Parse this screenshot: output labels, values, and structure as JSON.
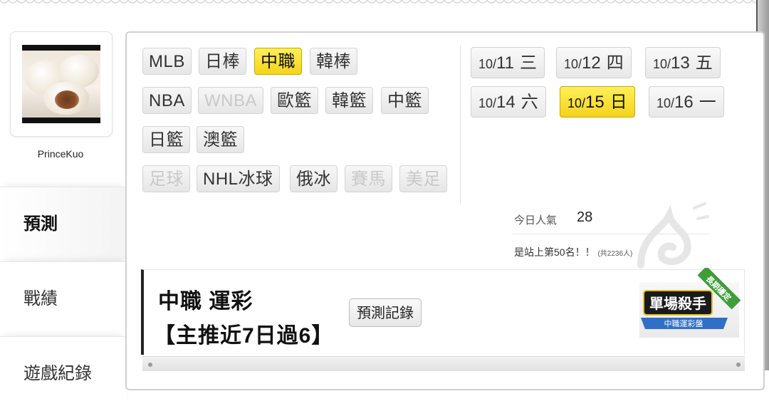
{
  "profile": {
    "username": "PrinceKuo",
    "avatar_alt": "steamed buns"
  },
  "left_menu": [
    {
      "label": "預測",
      "active": true
    },
    {
      "label": "戰績",
      "active": false
    },
    {
      "label": "遊戲紀錄",
      "active": false
    }
  ],
  "sports": {
    "rows": [
      [
        {
          "label": "MLB",
          "state": "normal"
        },
        {
          "label": "日棒",
          "state": "normal"
        },
        {
          "label": "中職",
          "state": "active"
        },
        {
          "label": "韓棒",
          "state": "normal"
        }
      ],
      [
        {
          "label": "NBA",
          "state": "normal"
        },
        {
          "label": "WNBA",
          "state": "disabled"
        },
        {
          "label": "歐籃",
          "state": "normal"
        },
        {
          "label": "韓籃",
          "state": "normal"
        },
        {
          "label": "中籃",
          "state": "normal"
        }
      ],
      [
        {
          "label": "日籃",
          "state": "normal"
        },
        {
          "label": "澳籃",
          "state": "normal"
        }
      ],
      [
        {
          "label": "足球",
          "state": "disabled"
        },
        {
          "label": "NHL冰球",
          "state": "normal"
        },
        {
          "label": "俄冰",
          "state": "normal"
        },
        {
          "label": "賽馬",
          "state": "disabled"
        },
        {
          "label": "美足",
          "state": "disabled"
        }
      ]
    ]
  },
  "dates": [
    {
      "md": "10/",
      "d": "11",
      "weekday": "三",
      "active": false
    },
    {
      "md": "10/",
      "d": "12",
      "weekday": "四",
      "active": false
    },
    {
      "md": "10/",
      "d": "13",
      "weekday": "五",
      "active": false
    },
    {
      "md": "10/",
      "d": "14",
      "weekday": "六",
      "active": false
    },
    {
      "md": "10/",
      "d": "15",
      "weekday": "日",
      "active": true
    },
    {
      "md": "10/",
      "d": "16",
      "weekday": "一",
      "active": false
    }
  ],
  "stats": {
    "today_popularity_label": "今日人氣",
    "today_popularity_value": "28",
    "rank_text": "是站上第50名！！",
    "rank_total": "(共2236人)"
  },
  "pick": {
    "title": "中職 運彩",
    "subtitle": "【主推近7日過6】",
    "record_button": "預測記錄"
  },
  "badge": {
    "main": "單場殺手",
    "sub": "中職運彩盤",
    "ribbon": "長期穩定"
  },
  "colors": {
    "accent_yellow": "#f4d31c",
    "badge_blue": "#2f6fc7",
    "badge_green": "#3f9d3a"
  }
}
